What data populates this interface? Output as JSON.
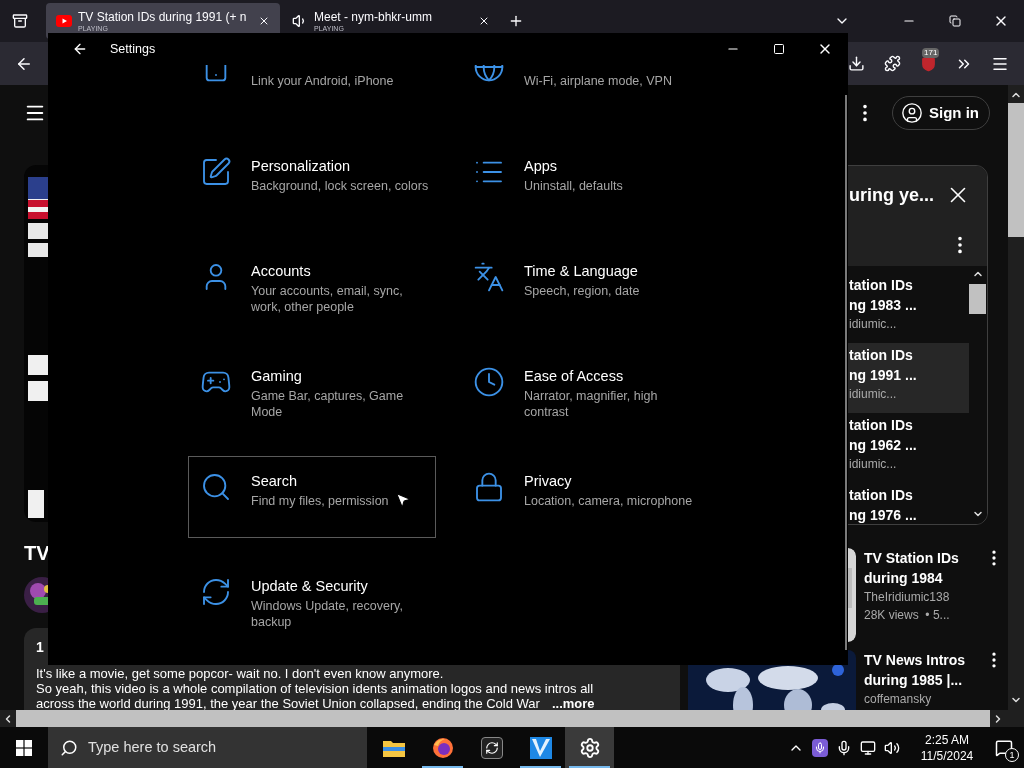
{
  "browser": {
    "tabs": [
      {
        "title": "TV Station IDs during 1991 (+ n",
        "status": "PLAYING",
        "selected": true
      },
      {
        "title": "Meet - nym-bhkr-umm",
        "status": "PLAYING",
        "selected": false
      }
    ],
    "extension_badge": "171"
  },
  "youtube": {
    "sign_in": "Sign in",
    "video_title": "TV",
    "description": {
      "lead": "1",
      "lines": [
        "It's like a movie, get some popcor- wait no. I don't even know anymore.",
        "So yeah, this video is a whole compilation of television idents animation logos and news intros all",
        "across the world during 1991, the year the Soviet Union collapsed, ending the Cold War"
      ],
      "more": "...more"
    },
    "playlist": {
      "title": "uring ye...",
      "items": [
        {
          "line1": "tation IDs",
          "line2": "ng 1983 ...",
          "channel": "idiumic...",
          "selected": false
        },
        {
          "line1": "tation IDs",
          "line2": "ng 1991 ...",
          "channel": "idiumic...",
          "selected": true
        },
        {
          "line1": "tation IDs",
          "line2": "ng 1962 ...",
          "channel": "idiumic...",
          "selected": false
        },
        {
          "line1": "tation IDs",
          "line2": "ng 1976 ...",
          "selected": false
        }
      ]
    },
    "recommendations": [
      {
        "title": [
          "TV Station IDs",
          "during 1984"
        ],
        "channel": "TheIridiumic138",
        "meta": "28K views  • 5..."
      },
      {
        "title": [
          "TV News Intros",
          "during 1985 |..."
        ],
        "channel": "coffemansky"
      }
    ]
  },
  "settings": {
    "title": "Settings",
    "items": [
      {
        "subtitle": [
          "Link your Android, iPhone"
        ],
        "highlighted": false
      },
      {
        "subtitle": [
          "Wi-Fi, airplane mode, VPN"
        ],
        "highlighted": false
      },
      {
        "title": "Personalization",
        "subtitle": [
          "Background, lock screen, colors"
        ],
        "highlighted": false
      },
      {
        "title": "Apps",
        "subtitle": [
          "Uninstall, defaults"
        ],
        "highlighted": false
      },
      {
        "title": "Accounts",
        "subtitle": [
          "Your accounts, email, sync,",
          "work, other people"
        ],
        "highlighted": false
      },
      {
        "title": "Time & Language",
        "subtitle": [
          "Speech, region, date"
        ],
        "highlighted": false
      },
      {
        "title": "Gaming",
        "subtitle": [
          "Game Bar, captures, Game",
          "Mode"
        ],
        "highlighted": false
      },
      {
        "title": "Ease of Access",
        "subtitle": [
          "Narrator, magnifier, high",
          "contrast"
        ],
        "highlighted": false
      },
      {
        "title": "Search",
        "subtitle": [
          "Find my files, permission"
        ],
        "highlighted": true
      },
      {
        "title": "Privacy",
        "subtitle": [
          "Location, camera, microphone"
        ],
        "highlighted": false
      },
      {
        "title": "Update & Security",
        "subtitle": [
          "Windows Update, recovery,",
          "backup"
        ],
        "highlighted": false
      }
    ]
  },
  "taskbar": {
    "search_placeholder": "Type here to search",
    "apps": [
      {
        "running": false,
        "active": false
      },
      {
        "running": true,
        "active": false
      },
      {
        "running": false,
        "active": false
      },
      {
        "running": true,
        "active": false
      },
      {
        "running": true,
        "active": true
      }
    ],
    "time": "2:25 AM",
    "date": "11/5/2024",
    "notification_count": "1"
  }
}
